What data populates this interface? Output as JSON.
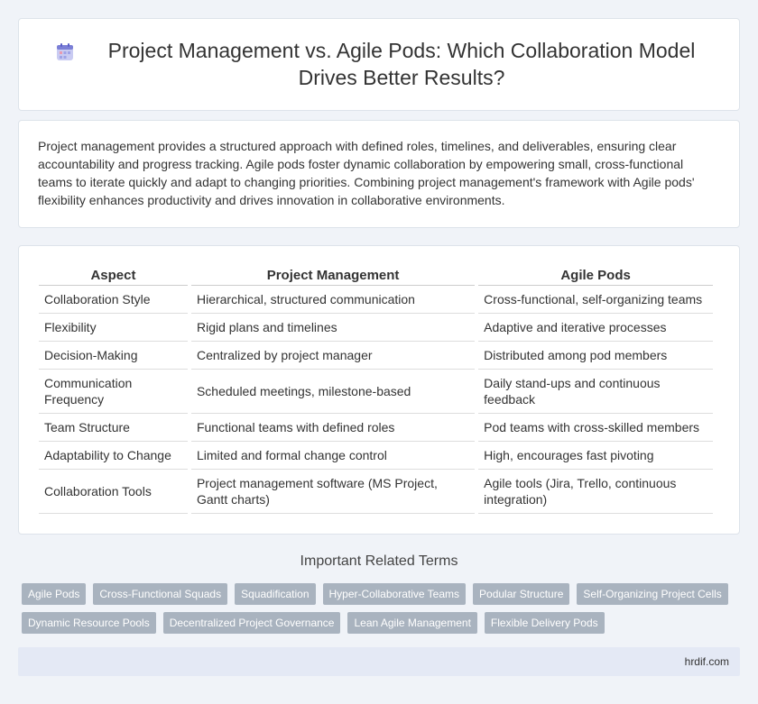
{
  "header": {
    "title": "Project Management vs. Agile Pods: Which Collaboration Model Drives Better Results?",
    "icon": "calendar-icon",
    "icon_color": "#7b7fd6"
  },
  "intro": {
    "text": "Project management provides a structured approach with defined roles, timelines, and deliverables, ensuring clear accountability and progress tracking. Agile pods foster dynamic collaboration by empowering small, cross-functional teams to iterate quickly and adapt to changing priorities. Combining project management's framework with Agile pods' flexibility enhances productivity and drives innovation in collaborative environments."
  },
  "table": {
    "headers": [
      "Aspect",
      "Project Management",
      "Agile Pods"
    ],
    "rows": [
      [
        "Collaboration Style",
        "Hierarchical, structured communication",
        "Cross-functional, self-organizing teams"
      ],
      [
        "Flexibility",
        "Rigid plans and timelines",
        "Adaptive and iterative processes"
      ],
      [
        "Decision-Making",
        "Centralized by project manager",
        "Distributed among pod members"
      ],
      [
        "Communication Frequency",
        "Scheduled meetings, milestone-based",
        "Daily stand-ups and continuous feedback"
      ],
      [
        "Team Structure",
        "Functional teams with defined roles",
        "Pod teams with cross-skilled members"
      ],
      [
        "Adaptability to Change",
        "Limited and formal change control",
        "High, encourages fast pivoting"
      ],
      [
        "Collaboration Tools",
        "Project management software (MS Project, Gantt charts)",
        "Agile tools (Jira, Trello, continuous integration)"
      ]
    ]
  },
  "related": {
    "title": "Important Related Terms",
    "rows": [
      [
        "Agile Pods",
        "Cross-Functional Squads",
        "Squadification",
        "Hyper-Collaborative Teams",
        "Podular Structure",
        "Self-Organizing Project Cells"
      ],
      [
        "Dynamic Resource Pools",
        "Decentralized Project Governance",
        "Lean Agile Management",
        "Flexible Delivery Pods"
      ]
    ]
  },
  "footer": {
    "site": "hrdif.com"
  }
}
